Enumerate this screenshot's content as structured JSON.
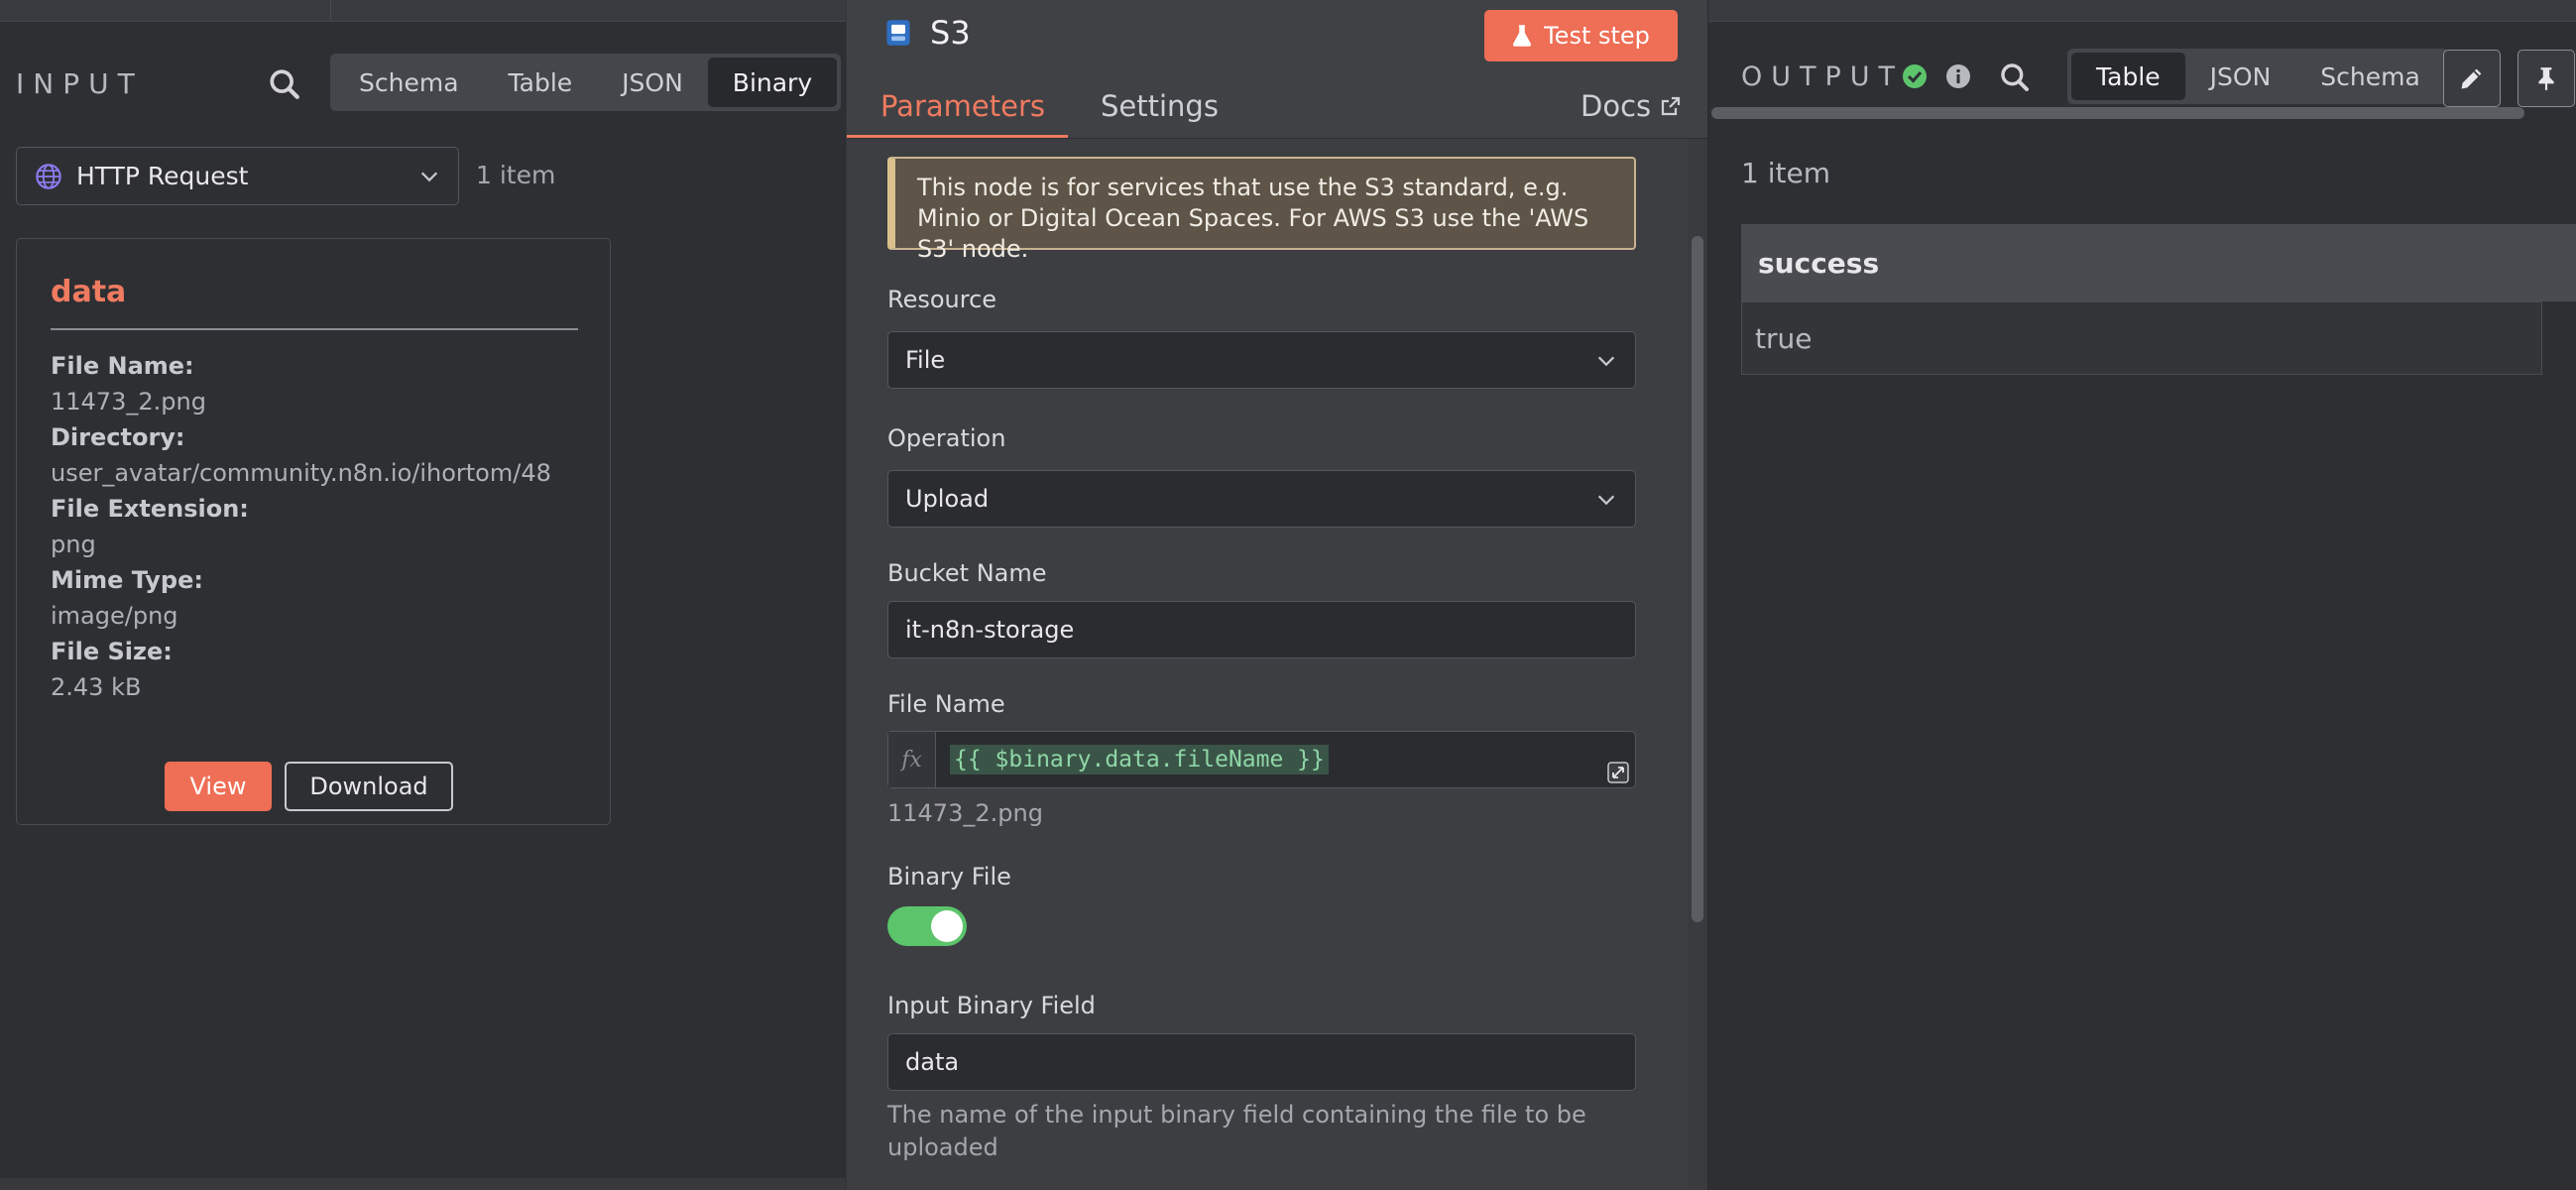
{
  "input": {
    "title": "INPUT",
    "tabs": [
      "Schema",
      "Table",
      "JSON",
      "Binary"
    ],
    "active_tab": "Binary",
    "node_select": "HTTP Request",
    "item_count": "1 item",
    "binary": {
      "title": "data",
      "fields": [
        {
          "label": "File Name:",
          "value": "11473_2.png"
        },
        {
          "label": "Directory:",
          "value": "user_avatar/community.n8n.io/ihortom/48"
        },
        {
          "label": "File Extension:",
          "value": "png"
        },
        {
          "label": "Mime Type:",
          "value": "image/png"
        },
        {
          "label": "File Size:",
          "value": "2.43 kB"
        }
      ],
      "view_label": "View",
      "download_label": "Download"
    }
  },
  "node": {
    "title": "S3",
    "test_label": "Test step",
    "tabs": [
      "Parameters",
      "Settings"
    ],
    "active_tab": "Parameters",
    "docs_label": "Docs",
    "notice": "This node is for services that use the S3 standard, e.g. Minio or Digital Ocean Spaces. For AWS S3 use the 'AWS S3' node.",
    "resource": {
      "label": "Resource",
      "value": "File"
    },
    "operation": {
      "label": "Operation",
      "value": "Upload"
    },
    "bucket": {
      "label": "Bucket Name",
      "value": "it-n8n-storage"
    },
    "file_name": {
      "label": "File Name",
      "fx": "fx",
      "expression": "{{ $binary.data.fileName }}",
      "resolved": "11473_2.png"
    },
    "binary_file": {
      "label": "Binary File",
      "on": true
    },
    "input_binary_field": {
      "label": "Input Binary Field",
      "value": "data",
      "hint": "The name of the input binary field containing the file to be uploaded"
    }
  },
  "output": {
    "title": "OUTPUT",
    "tabs": [
      "Table",
      "JSON",
      "Schema"
    ],
    "active_tab": "Table",
    "item_count": "1 item",
    "table": {
      "header": "success",
      "value": "true"
    },
    "colors": {
      "success": "#5cc46b",
      "accent": "#ee6e56"
    }
  }
}
